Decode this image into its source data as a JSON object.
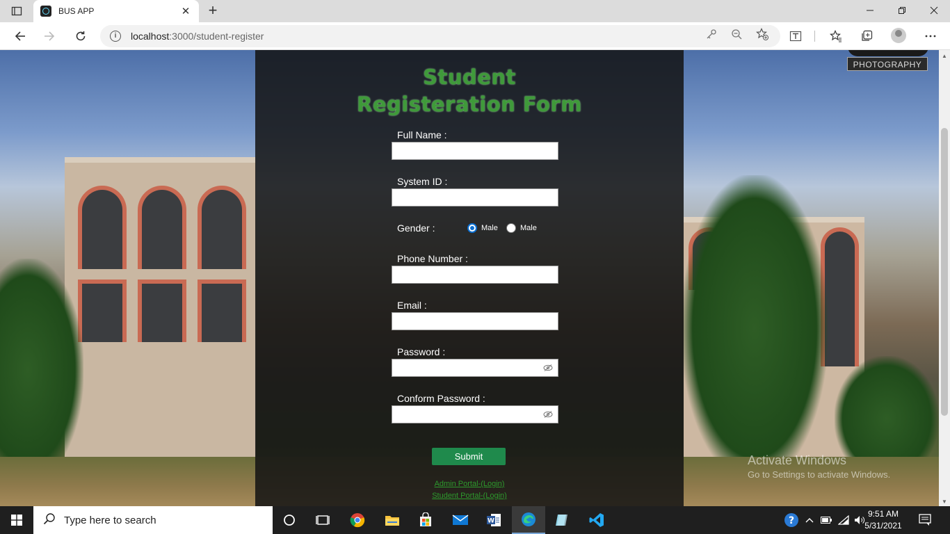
{
  "browser": {
    "tab_title": "BUS APP",
    "url_host": "localhost",
    "url_path": ":3000/student-register"
  },
  "page": {
    "watermark": "PHOTOGRAPHY",
    "title_line1": "Student",
    "title_line2": "Registeration Form",
    "fields": {
      "full_name_label": "Full Name :",
      "system_id_label": "System ID :",
      "gender_label": "Gender :",
      "gender_option1": "Male",
      "gender_option2": "Male",
      "gender_selected": "option1",
      "phone_label": "Phone Number :",
      "email_label": "Email :",
      "password_label": "Password :",
      "confirm_password_label": "Conform Password :"
    },
    "submit_label": "Submit",
    "links": {
      "admin": "Admin Portal-(Login)",
      "student": "Student Portal-(Login)"
    },
    "activate": {
      "line1": "Activate Windows",
      "line2": "Go to Settings to activate Windows."
    }
  },
  "taskbar": {
    "search_placeholder": "Type here to search",
    "time": "9:51 AM",
    "date": "5/31/2021"
  }
}
